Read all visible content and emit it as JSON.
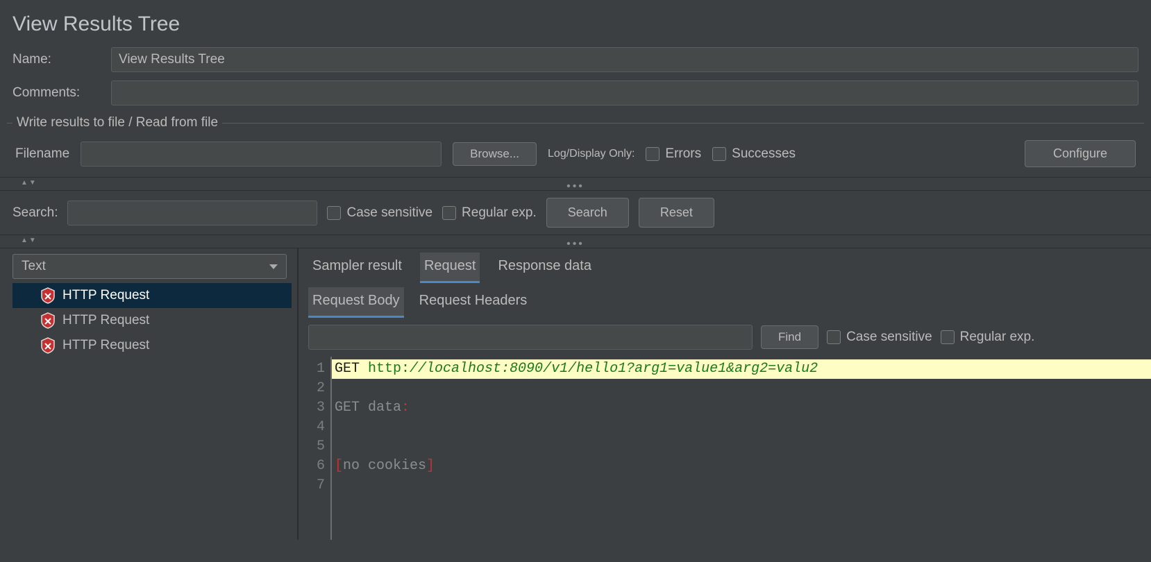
{
  "title": "View Results Tree",
  "form": {
    "name_label": "Name:",
    "name_value": "View Results Tree",
    "comments_label": "Comments:",
    "comments_value": ""
  },
  "file_section": {
    "legend": "Write results to file / Read from file",
    "filename_label": "Filename",
    "filename_value": "",
    "browse_btn": "Browse...",
    "log_display_label": "Log/Display Only:",
    "errors_label": "Errors",
    "successes_label": "Successes",
    "configure_btn": "Configure"
  },
  "search": {
    "label": "Search:",
    "value": "",
    "case_label": "Case sensitive",
    "regex_label": "Regular exp.",
    "search_btn": "Search",
    "reset_btn": "Reset"
  },
  "renderer": {
    "selected": "Text"
  },
  "results": [
    {
      "label": "HTTP Request",
      "selected": true
    },
    {
      "label": "HTTP Request",
      "selected": false
    },
    {
      "label": "HTTP Request",
      "selected": false
    }
  ],
  "tabs": {
    "items": [
      "Sampler result",
      "Request",
      "Response data"
    ],
    "active": "Request"
  },
  "subtabs": {
    "items": [
      "Request Body",
      "Request Headers"
    ],
    "active": "Request Body"
  },
  "find": {
    "value": "",
    "find_btn": "Find",
    "case_label": "Case sensitive",
    "regex_label": "Regular exp."
  },
  "request_body": {
    "line1_method": "GET ",
    "line1_scheme": "http:",
    "line1_url": "//localhost:8090/v1/hello1?arg1=value1&arg2=valu2",
    "line3_text": "GET data",
    "line3_colon": ":",
    "line6_open": "[",
    "line6_text": "no cookies",
    "line6_close": "]",
    "line_numbers": [
      "1",
      "2",
      "3",
      "4",
      "5",
      "6",
      "7"
    ]
  }
}
